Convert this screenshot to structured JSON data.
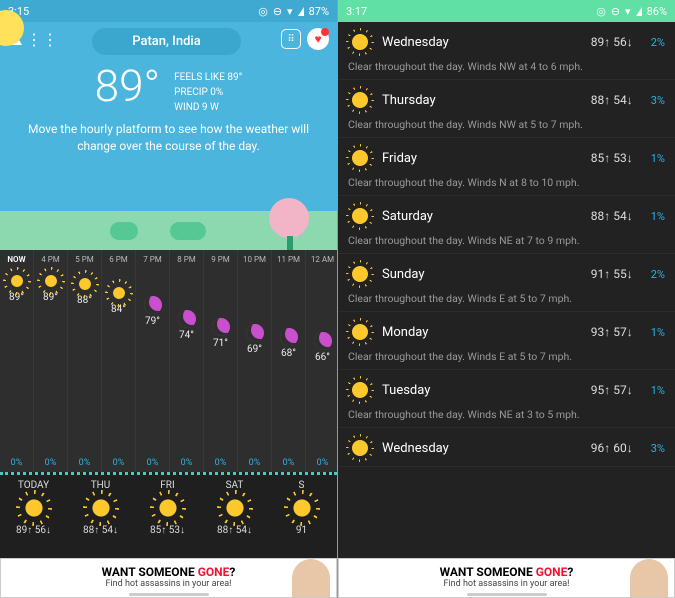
{
  "p1": {
    "status": {
      "time": "3:15",
      "battery": "87%"
    },
    "location": "Patan, India",
    "temp": "89°",
    "feels": "FEELS LIKE 89°",
    "precip": "PRECIP 0%",
    "wind": "WIND 9 W",
    "hint": "Move the hourly platform to see how the weather will change over the course of the day.",
    "hourly": [
      {
        "t": "NOW",
        "d": "89°",
        "p": "0%",
        "k": "sun",
        "off": 0
      },
      {
        "t": "4 PM",
        "d": "89°",
        "p": "0%",
        "k": "sun",
        "off": 0
      },
      {
        "t": "5 PM",
        "d": "88°",
        "p": "0%",
        "k": "sun",
        "off": 3
      },
      {
        "t": "6 PM",
        "d": "84°",
        "p": "0%",
        "k": "sun",
        "off": 12
      },
      {
        "t": "7 PM",
        "d": "79°",
        "p": "0%",
        "k": "moon",
        "off": 24
      },
      {
        "t": "8 PM",
        "d": "74°",
        "p": "0%",
        "k": "moon",
        "off": 38
      },
      {
        "t": "9 PM",
        "d": "71°",
        "p": "0%",
        "k": "moon",
        "off": 46
      },
      {
        "t": "10 PM",
        "d": "69°",
        "p": "0%",
        "k": "moon",
        "off": 52
      },
      {
        "t": "11 PM",
        "d": "68°",
        "p": "0%",
        "k": "moon",
        "off": 56
      },
      {
        "t": "12 AM",
        "d": "66°",
        "p": "0%",
        "k": "moon",
        "off": 60
      }
    ],
    "daily": [
      {
        "n": "TODAY",
        "h": "89↑",
        "l": "56↓"
      },
      {
        "n": "THU",
        "h": "88↑",
        "l": "54↓"
      },
      {
        "n": "FRI",
        "h": "85↑",
        "l": "53↓"
      },
      {
        "n": "SAT",
        "h": "88↑",
        "l": "54↓"
      },
      {
        "n": "S",
        "h": "91",
        "l": ""
      }
    ]
  },
  "p2": {
    "status": {
      "time": "3:17",
      "battery": "86%"
    },
    "days": [
      {
        "n": "Wednesday",
        "h": "89↑",
        "l": "56↓",
        "p": "2%",
        "d": "Clear throughout the day. Winds NW at 4 to 6 mph."
      },
      {
        "n": "Thursday",
        "h": "88↑",
        "l": "54↓",
        "p": "3%",
        "d": "Clear throughout the day. Winds NW at 5 to 7 mph."
      },
      {
        "n": "Friday",
        "h": "85↑",
        "l": "53↓",
        "p": "1%",
        "d": "Clear throughout the day. Winds N at 8 to 10 mph."
      },
      {
        "n": "Saturday",
        "h": "88↑",
        "l": "54↓",
        "p": "1%",
        "d": "Clear throughout the day. Winds NE at 7 to 9 mph."
      },
      {
        "n": "Sunday",
        "h": "91↑",
        "l": "55↓",
        "p": "2%",
        "d": "Clear throughout the day. Winds E at 5 to 7 mph."
      },
      {
        "n": "Monday",
        "h": "93↑",
        "l": "57↓",
        "p": "1%",
        "d": "Clear throughout the day. Winds E at 5 to 7 mph."
      },
      {
        "n": "Tuesday",
        "h": "95↑",
        "l": "57↓",
        "p": "1%",
        "d": "Clear throughout the day. Winds NE at 3 to 5 mph."
      },
      {
        "n": "Wednesday",
        "h": "96↑",
        "l": "60↓",
        "p": "3%",
        "d": ""
      }
    ]
  },
  "ad": {
    "line1a": "WANT SOMEONE ",
    "line1b": "GONE",
    "line1c": "?",
    "line2": "Find hot assassins in your area!"
  }
}
